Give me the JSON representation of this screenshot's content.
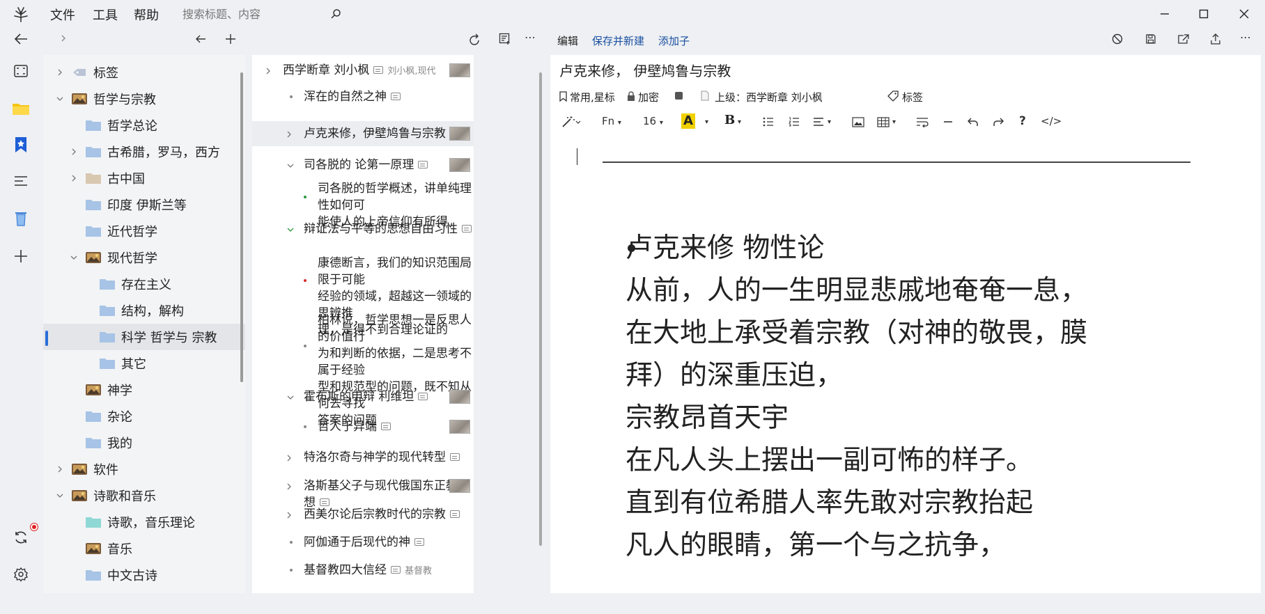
{
  "menu": {
    "file": "文件",
    "tools": "工具",
    "help": "帮助"
  },
  "search": {
    "placeholder": "搜索标题、内容"
  },
  "tree": [
    {
      "label": "标签",
      "chevron": "›",
      "indent": 0,
      "icon": "tag"
    },
    {
      "label": "哲学与宗教",
      "chevron": "⌄",
      "indent": 0,
      "icon": "image"
    },
    {
      "label": "哲学总论",
      "chevron": "",
      "indent": 1,
      "icon": "folder"
    },
    {
      "label": "古希腊，罗马，西方",
      "chevron": "›",
      "indent": 1,
      "icon": "folder"
    },
    {
      "label": "古中国",
      "chevron": "›",
      "indent": 1,
      "icon": "folder-tan"
    },
    {
      "label": "印度 伊斯兰等",
      "chevron": "",
      "indent": 1,
      "icon": "folder"
    },
    {
      "label": "近代哲学",
      "chevron": "",
      "indent": 1,
      "icon": "folder"
    },
    {
      "label": "现代哲学",
      "chevron": "⌄",
      "indent": 1,
      "icon": "image"
    },
    {
      "label": "存在主义",
      "chevron": "",
      "indent": 2,
      "icon": "folder"
    },
    {
      "label": "结构，解构",
      "chevron": "",
      "indent": 2,
      "icon": "folder"
    },
    {
      "label": "科学 哲学与 宗教",
      "chevron": "",
      "indent": 2,
      "icon": "folder",
      "selected": true
    },
    {
      "label": "其它",
      "chevron": "",
      "indent": 2,
      "icon": "folder"
    },
    {
      "label": "神学",
      "chevron": "",
      "indent": 1,
      "icon": "image"
    },
    {
      "label": "杂论",
      "chevron": "",
      "indent": 1,
      "icon": "folder"
    },
    {
      "label": "我的",
      "chevron": "",
      "indent": 1,
      "icon": "folder"
    },
    {
      "label": "软件",
      "chevron": "›",
      "indent": 0,
      "icon": "image"
    },
    {
      "label": "诗歌和音乐",
      "chevron": "⌄",
      "indent": 0,
      "icon": "image"
    },
    {
      "label": "诗歌，音乐理论",
      "chevron": "",
      "indent": 1,
      "icon": "folder-teal"
    },
    {
      "label": "音乐",
      "chevron": "",
      "indent": 1,
      "icon": "image"
    },
    {
      "label": "中文古诗",
      "chevron": "",
      "indent": 1,
      "icon": "folder"
    }
  ],
  "notes": [
    {
      "title": "西学断章  刘小枫",
      "tag": "刘小枫,现代",
      "marker": "chevron-right",
      "level": 0,
      "thumb": true
    },
    {
      "title": "浑在的自然之神",
      "marker": "dot",
      "level": 1
    },
    {
      "title": "卢克来修，伊壁鸠鲁与宗教",
      "marker": "chevron-right",
      "level": 1,
      "thumb": true,
      "selected": true
    },
    {
      "title": "司各脱的 论第一原理",
      "marker": "chevron-down",
      "level": 1,
      "thumb": true
    },
    {
      "lines": [
        "司各脱的哲学概述，讲单纯理性如何可",
        "能使人的上帝信仰有所得"
      ],
      "marker": "dot-green",
      "level": 2
    },
    {
      "title": "辩证法与平等的思想自由习性",
      "marker": "chevron-down-green",
      "level": 1
    },
    {
      "lines": [
        "康德断言，我们的知识范围局限于可能",
        "经验的领域，超越这一领域的思辨推",
        "理，是得不到合理论证的"
      ],
      "marker": "dot-red",
      "level": 2
    },
    {
      "lines": [
        "柏林说，哲学思想一是反思人的价值行",
        "为和判断的依据，二是思考不属于经验",
        "型和规范型的问题，既不知从何去寻找",
        "答案的问题"
      ],
      "marker": "dot",
      "level": 2
    },
    {
      "title": "霍布斯的申辩 利维坦",
      "marker": "chevron-down",
      "level": 1,
      "thumb": true
    },
    {
      "title": "哲人于异端",
      "marker": "dot",
      "level": 2,
      "thumb": true
    },
    {
      "title": "特洛尔奇与神学的现代转型",
      "marker": "chevron-right",
      "level": 1
    },
    {
      "title": "洛斯基父子与现代俄国东正教思想",
      "marker": "chevron-right",
      "level": 1,
      "thumb": true
    },
    {
      "title": "西美尔论后宗教时代的宗教",
      "marker": "chevron-right",
      "level": 1
    },
    {
      "title": "阿伽通于后现代的神",
      "marker": "dot",
      "level": 1
    },
    {
      "title": "基督教四大信经",
      "tag": "基督教",
      "marker": "dot",
      "level": 1
    }
  ],
  "editor": {
    "toolbar": {
      "edit": "编辑",
      "save_new": "保存并新建",
      "add_child": "添加子"
    },
    "title": "卢克来修， 伊壁鸠鲁与宗教",
    "props": {
      "star": "常用,星标",
      "encrypt": "加密",
      "parent": "上级：西学断章  刘小枫",
      "tags": "标签"
    },
    "format": {
      "font": "Fn",
      "size": "16",
      "highlight": "A",
      "bold": "B",
      "help": "?",
      "code": "</>"
    },
    "content": [
      "卢克来修 物性论",
      "从前，人的一生明显悲戚地奄奄一息，",
      "在大地上承受着宗教（对神的敬畏，膜",
      "拜）的深重压迫，",
      "宗教昂首天宇",
      "在凡人头上摆出一副可怖的样子。",
      "直到有位希腊人率先敢对宗教抬起",
      "凡人的眼睛，第一个与之抗争，"
    ]
  },
  "colors": {
    "accent": "#2a6dd8",
    "link": "#1a4fa0",
    "bookmark": "#1e5ed6",
    "trash": "#4a8fe0",
    "sync_dot": "#e02020",
    "folder": "#a7c3e6",
    "highlight": "#f0d000"
  }
}
